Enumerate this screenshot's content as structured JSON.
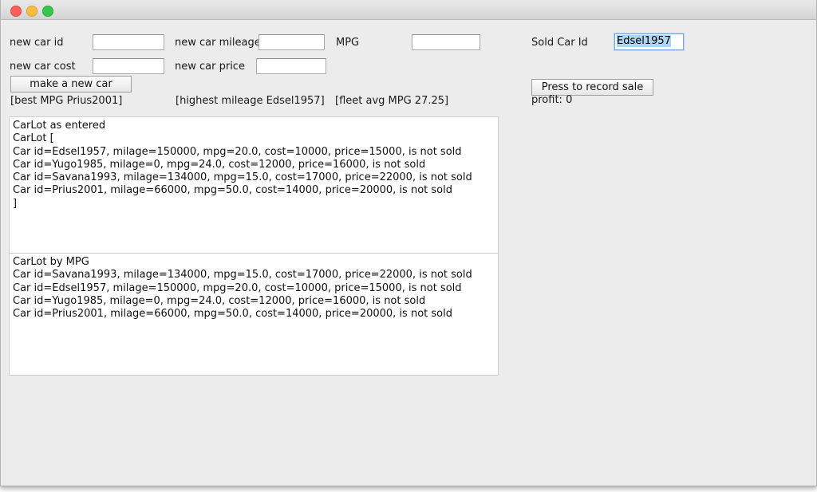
{
  "window": {
    "traffic_lights": [
      {
        "name": "close",
        "color": "#fc6058"
      },
      {
        "name": "minimize",
        "color": "#fdbc40"
      },
      {
        "name": "maximize",
        "color": "#34c84a"
      }
    ],
    "background_color": "#ececec"
  },
  "form": {
    "new_car_id": {
      "label": "new car id",
      "value": ""
    },
    "new_car_mileage": {
      "label": "new car mileage",
      "value": ""
    },
    "mpg": {
      "label": "MPG",
      "value": ""
    },
    "new_car_cost": {
      "label": "new car cost",
      "value": ""
    },
    "new_car_price": {
      "label": "new car price",
      "value": ""
    },
    "make_button": "make a new car"
  },
  "sale": {
    "sold_car_id_label": "Sold Car Id",
    "sold_car_id_value": "Edsel1957",
    "sold_car_id_selected": true,
    "selection_color": "#b0d4f1",
    "record_button": "Press to record sale",
    "profit": "profit: 0"
  },
  "status": {
    "best_mpg": "[best MPG Prius2001]",
    "highest_mileage": "[highest mileage Edsel1957]",
    "fleet_avg_mpg": "[fleet avg MPG 27.25]"
  },
  "carlot_as_entered": {
    "lines": [
      "CarLot as entered",
      "CarLot [",
      "Car id=Edsel1957, milage=150000, mpg=20.0, cost=10000, price=15000, is not sold",
      "Car id=Yugo1985, milage=0, mpg=24.0, cost=12000, price=16000, is not sold",
      "Car id=Savana1993, milage=134000, mpg=15.0, cost=17000, price=22000, is not sold",
      "Car id=Prius2001, milage=66000, mpg=50.0, cost=14000, price=20000, is not sold",
      "]"
    ]
  },
  "carlot_by_mpg": {
    "lines": [
      "CarLot by MPG",
      "Car id=Savana1993, milage=134000, mpg=15.0, cost=17000, price=22000, is not sold",
      "Car id=Edsel1957, milage=150000, mpg=20.0, cost=10000, price=15000, is not sold",
      "Car id=Yugo1985, milage=0, mpg=24.0, cost=12000, price=16000, is not sold",
      "Car id=Prius2001, milage=66000, mpg=50.0, cost=14000, price=20000, is not sold"
    ]
  }
}
